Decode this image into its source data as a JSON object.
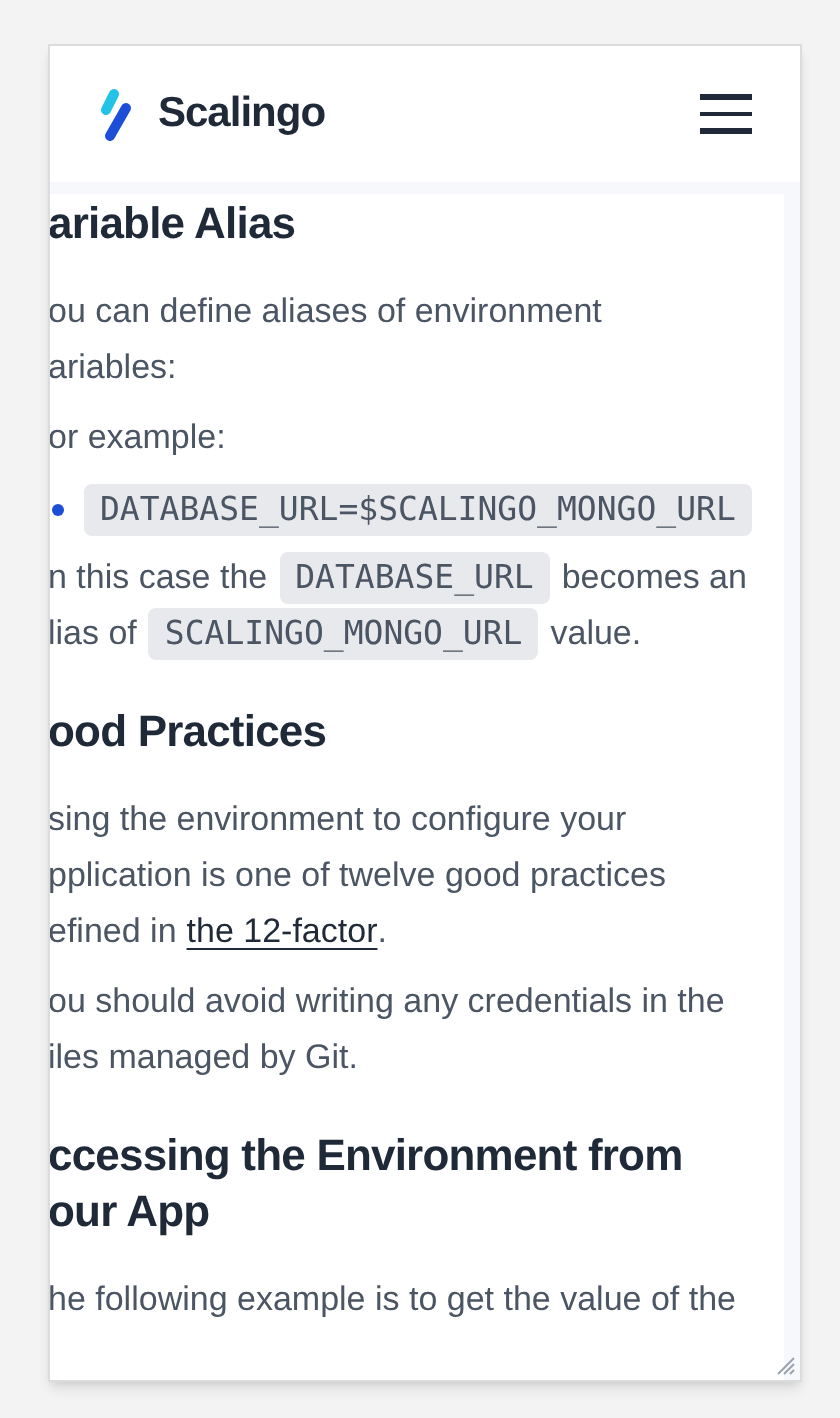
{
  "header": {
    "brand": "Scalingo"
  },
  "sections": [
    {
      "heading": [
        "ariable Alias"
      ],
      "blocks": [
        {
          "kind": "paragraph",
          "lines": [
            [
              {
                "kind": "text",
                "text": "ou can define aliases of environment"
              }
            ],
            [
              {
                "kind": "text",
                "text": "ariables:"
              }
            ]
          ]
        },
        {
          "kind": "paragraph",
          "lines": [
            [
              {
                "kind": "text",
                "text": "or example:"
              }
            ]
          ]
        },
        {
          "kind": "bullet",
          "lines": [
            [
              {
                "kind": "code",
                "text": "DATABASE_URL=$SCALINGO_MONGO_URL"
              }
            ]
          ]
        },
        {
          "kind": "paragraph",
          "lines": [
            [
              {
                "kind": "text",
                "text": "n this case the"
              },
              {
                "kind": "code",
                "text": "DATABASE_URL"
              },
              {
                "kind": "text",
                "text": "becomes an"
              }
            ],
            [
              {
                "kind": "text",
                "text": "lias of"
              },
              {
                "kind": "code",
                "text": "SCALINGO_MONGO_URL"
              },
              {
                "kind": "text",
                "text": "value."
              }
            ]
          ]
        }
      ]
    },
    {
      "heading": [
        "ood Practices"
      ],
      "blocks": [
        {
          "kind": "paragraph",
          "lines": [
            [
              {
                "kind": "text",
                "text": "sing the environment to configure your"
              }
            ],
            [
              {
                "kind": "text",
                "text": "pplication is one of twelve good practices"
              }
            ],
            [
              {
                "kind": "text",
                "text": "efined in"
              },
              {
                "kind": "link",
                "text": "the 12-factor"
              },
              {
                "kind": "text",
                "text": "."
              }
            ]
          ]
        },
        {
          "kind": "paragraph",
          "lines": [
            [
              {
                "kind": "text",
                "text": "ou should avoid writing any credentials in the"
              }
            ],
            [
              {
                "kind": "text",
                "text": "iles managed by Git."
              }
            ]
          ]
        }
      ]
    },
    {
      "heading": [
        "ccessing the Environment from",
        "our App"
      ],
      "blocks": [
        {
          "kind": "paragraph",
          "lines": [
            [
              {
                "kind": "text",
                "text": "he following example is to get the value of the"
              }
            ]
          ]
        }
      ]
    }
  ]
}
